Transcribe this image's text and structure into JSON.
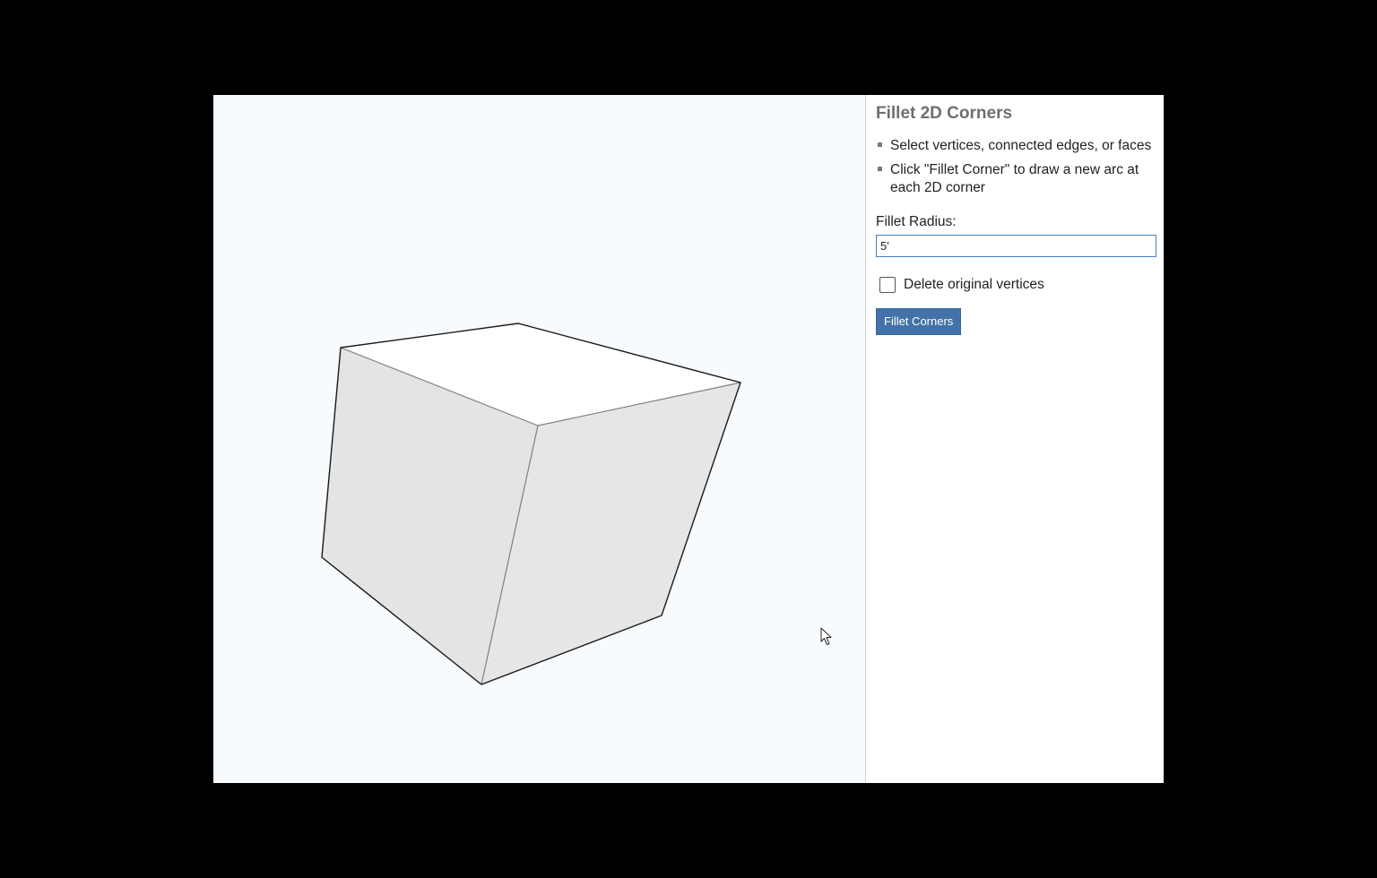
{
  "panel": {
    "title": "Fillet 2D Corners",
    "instructions": [
      "Select vertices, connected edges, or faces",
      "Click \"Fillet Corner\" to draw a new arc at each 2D corner"
    ],
    "radius_label": "Fillet Radius:",
    "radius_value": "5'",
    "delete_vertices_label": "Delete original vertices",
    "delete_vertices_checked": false,
    "fillet_button_label": "Fillet Corners"
  },
  "colors": {
    "viewport_bg": "#f7fbfd",
    "button_bg": "#4472a8",
    "top_face": "#ffffff",
    "side_face": "#e5e5e5"
  },
  "viewport": {
    "model": "cube",
    "cursor": "arrow-pointer-icon"
  }
}
